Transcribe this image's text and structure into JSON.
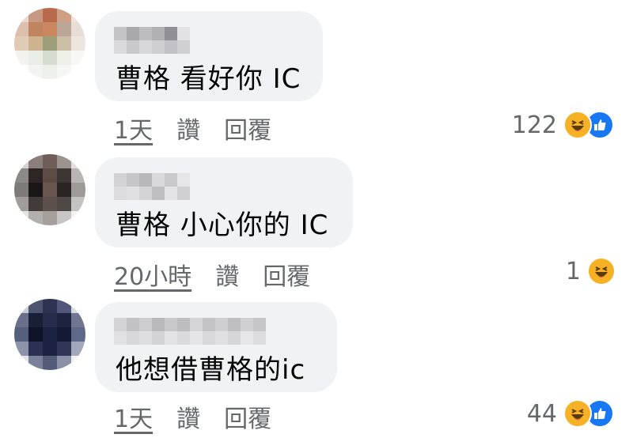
{
  "colors": {
    "bubble": "#f0f2f5",
    "text": "#050505",
    "meta": "#65676b",
    "haha": "#f7b125",
    "like": "#1877f2"
  },
  "comments": [
    {
      "author": "",
      "text": "曹格 看好你 IC",
      "time": "1天",
      "like_label": "讚",
      "reply_label": "回覆",
      "reaction_count": "122",
      "reactions": [
        "haha-icon",
        "like-icon"
      ]
    },
    {
      "author": "",
      "text": "曹格 小心你的 IC",
      "time": "20小時",
      "like_label": "讚",
      "reply_label": "回覆",
      "reaction_count": "1",
      "reactions": [
        "haha-icon"
      ]
    },
    {
      "author": "",
      "text": "他想借曹格的ic",
      "time": "1天",
      "like_label": "讚",
      "reply_label": "回覆",
      "reaction_count": "44",
      "reactions": [
        "haha-icon",
        "like-icon"
      ]
    }
  ]
}
